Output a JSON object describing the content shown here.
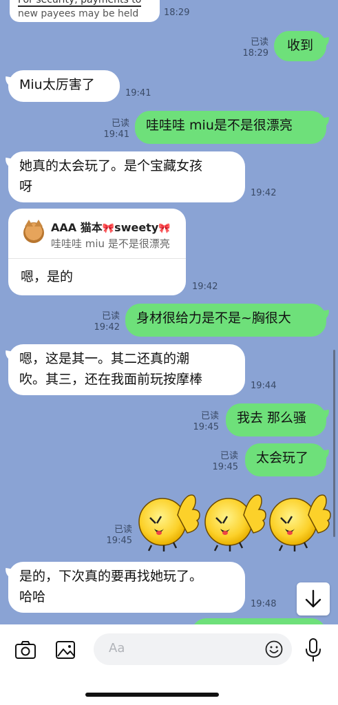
{
  "banner": {
    "line1": "For security, payments to",
    "line2": "new payees may be held for",
    "time": "18:29"
  },
  "messages": [
    {
      "id": "m1",
      "dir": "out",
      "text": "收到",
      "read": "已读",
      "time": "18:29"
    },
    {
      "id": "m2",
      "dir": "in",
      "text": "Miu太厉害了",
      "time": "19:41"
    },
    {
      "id": "m3",
      "dir": "out",
      "text": "哇哇哇  miu是不是很漂亮",
      "read": "已读",
      "time": "19:41"
    },
    {
      "id": "m4",
      "dir": "in",
      "line1": "她真的太会玩了。是个宝藏女孩",
      "line2": "呀",
      "time": "19:42"
    },
    {
      "id": "m5",
      "dir": "in",
      "reply_name": "AAA 猫本",
      "reply_name_suffix": "sweety",
      "reply_text": "哇哇哇 miu 是不是很漂亮",
      "text": "嗯，是的",
      "time": "19:42"
    },
    {
      "id": "m6",
      "dir": "out",
      "text": "身材很给力是不是~胸很大",
      "read": "已读",
      "time": "19:42"
    },
    {
      "id": "m7",
      "dir": "in",
      "line1": "嗯，这是其一。其二还真的潮",
      "line2": "吹。其三，还在我面前玩按摩棒",
      "time": "19:44"
    },
    {
      "id": "m8",
      "dir": "out",
      "text": "我去 那么骚",
      "read": "已读",
      "time": "19:45"
    },
    {
      "id": "m9",
      "dir": "out",
      "text": "太会玩了",
      "read": "已读",
      "time": "19:45"
    },
    {
      "id": "m10",
      "dir": "out",
      "sticker": "thumbs-up-chick-sticker",
      "read": "已读",
      "time": "19:45"
    },
    {
      "id": "m11",
      "dir": "in",
      "line1": "是的，下次真的要再找她玩了。",
      "line2": "哈哈",
      "time": "19:48"
    }
  ],
  "input": {
    "placeholder": "Aa"
  },
  "colors": {
    "background": "#8aa3d4",
    "outgoing_bubble": "#6ee07a",
    "incoming_bubble": "#ffffff"
  }
}
